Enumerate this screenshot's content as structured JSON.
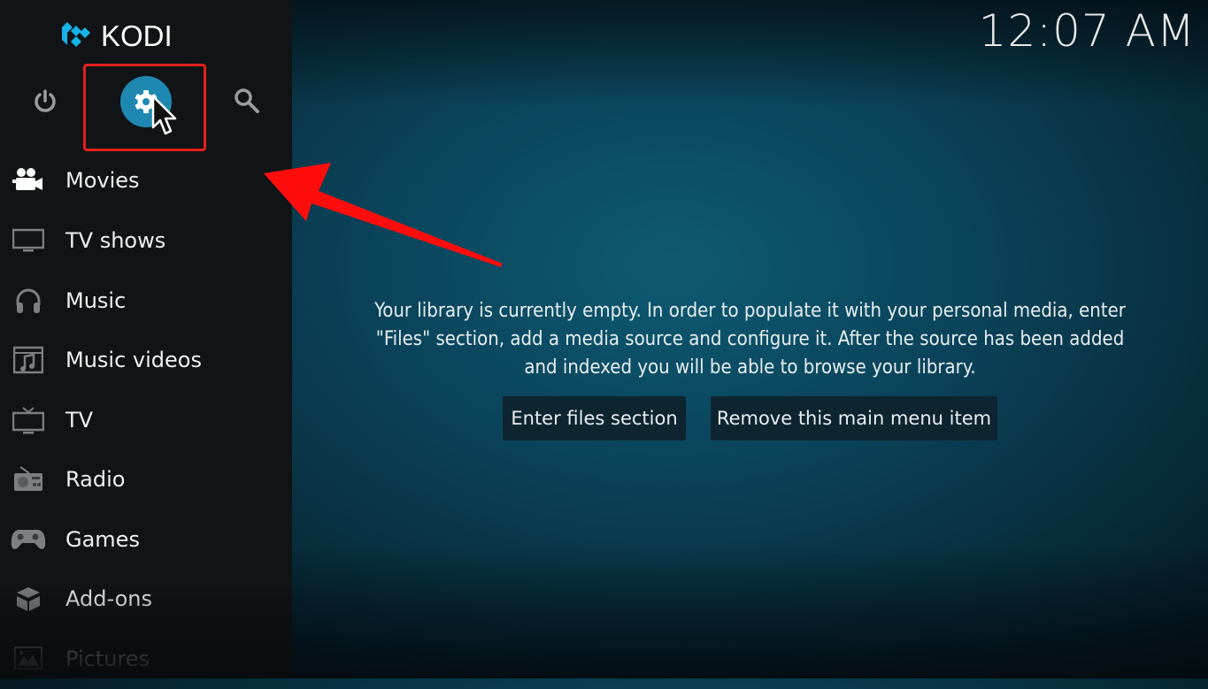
{
  "app": {
    "name": "KODI",
    "brand_color": "#17b2e8"
  },
  "clock": {
    "time": "12:07 AM"
  },
  "top_icons": [
    {
      "name": "power",
      "icon": "power-icon"
    },
    {
      "name": "settings",
      "icon": "gear-icon",
      "selected": true,
      "accent": "#1e88b0"
    },
    {
      "name": "search",
      "icon": "search-icon"
    }
  ],
  "menu": {
    "items": [
      {
        "label": "Movies",
        "icon": "movie-camera-icon",
        "active": true
      },
      {
        "label": "TV shows",
        "icon": "monitor-icon"
      },
      {
        "label": "Music",
        "icon": "headphones-icon"
      },
      {
        "label": "Music videos",
        "icon": "music-video-icon"
      },
      {
        "label": "TV",
        "icon": "tv-antenna-icon"
      },
      {
        "label": "Radio",
        "icon": "radio-icon"
      },
      {
        "label": "Games",
        "icon": "gamepad-icon"
      },
      {
        "label": "Add-ons",
        "icon": "box-icon"
      },
      {
        "label": "Pictures",
        "icon": "picture-icon"
      }
    ]
  },
  "main": {
    "message_lines": [
      "Your library is currently empty. In order to populate it with your personal media, enter",
      "\"Files\" section, add a media source and configure it. After the source has been added",
      "and indexed you will be able to browse your library."
    ],
    "buttons": {
      "enter_files": "Enter files section",
      "remove_item": "Remove this main menu item"
    }
  },
  "annotations": {
    "highlight_color": "#e3201b",
    "arrow_color": "#ff0d0d"
  }
}
